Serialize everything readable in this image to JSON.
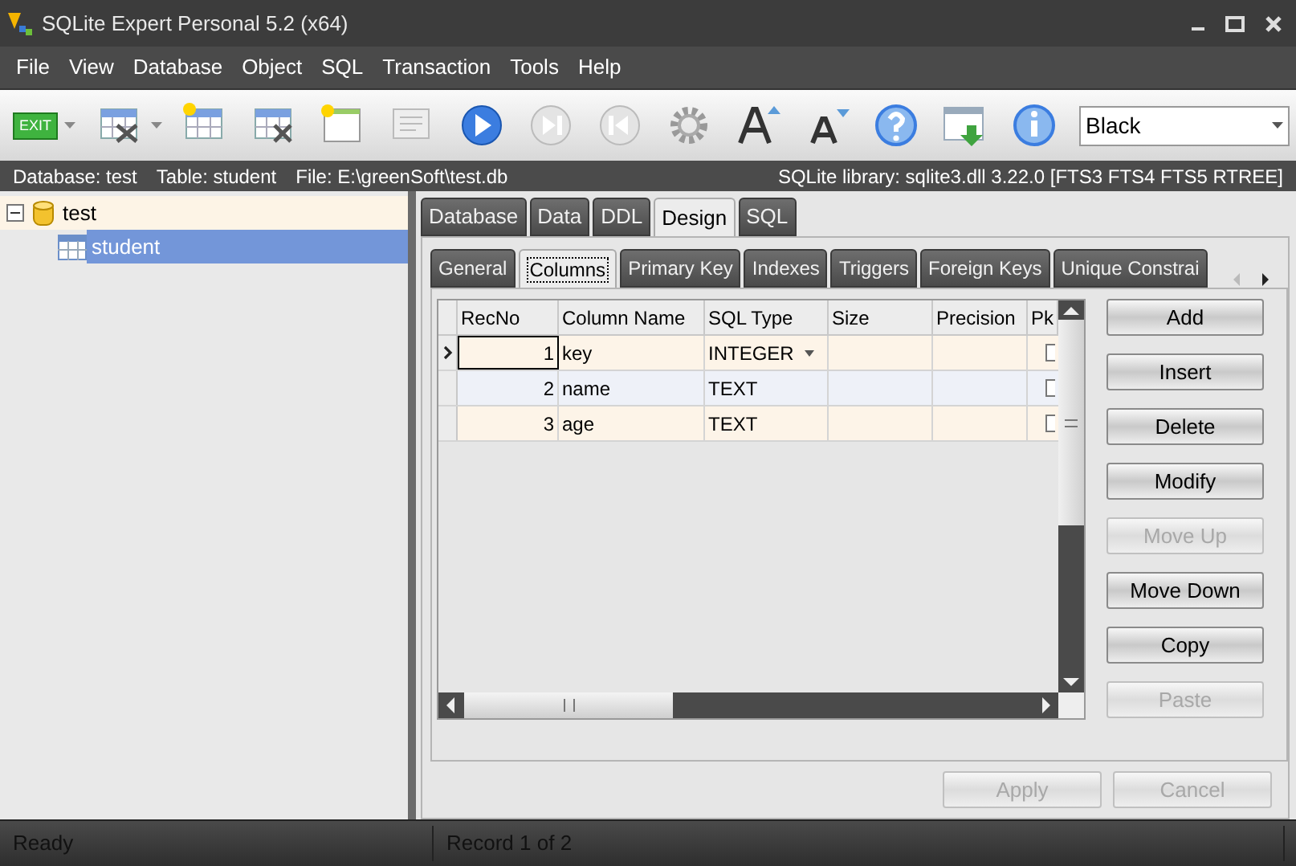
{
  "window": {
    "title": "SQLite Expert Personal 5.2 (x64)"
  },
  "menu": [
    "File",
    "View",
    "Database",
    "Object",
    "SQL",
    "Transaction",
    "Tools",
    "Help"
  ],
  "toolbar": {
    "exit_label": "EXIT",
    "theme": "Black"
  },
  "info_bar": {
    "left": [
      "Database: test",
      "Table: student",
      "File: E:\\greenSoft\\test.db"
    ],
    "right": "SQLite library: sqlite3.dll 3.22.0 [FTS3 FTS4 FTS5 RTREE]"
  },
  "tree": [
    {
      "label": "test",
      "expanded": true,
      "selected": false,
      "children": [
        {
          "label": "student",
          "selected": true
        }
      ]
    }
  ],
  "main_tabs": [
    {
      "label": "Database",
      "selected": false
    },
    {
      "label": "Data",
      "selected": false
    },
    {
      "label": "DDL",
      "selected": false
    },
    {
      "label": "Design",
      "selected": true
    },
    {
      "label": "SQL",
      "selected": false
    }
  ],
  "sub_tabs": [
    {
      "label": "General",
      "selected": false
    },
    {
      "label": "Columns",
      "selected": true
    },
    {
      "label": "Primary Key",
      "selected": false
    },
    {
      "label": "Indexes",
      "selected": false
    },
    {
      "label": "Triggers",
      "selected": false
    },
    {
      "label": "Foreign Keys",
      "selected": false
    },
    {
      "label": "Unique Constrai",
      "selected": false
    }
  ],
  "grid": {
    "columns": [
      "RecNo",
      "Column Name",
      "SQL Type",
      "Size",
      "Precision",
      "Pk"
    ],
    "rows": [
      {
        "cells": [
          "1",
          "key",
          "INTEGER",
          "",
          ""
        ],
        "current": true
      },
      {
        "cells": [
          "2",
          "name",
          "TEXT",
          "",
          ""
        ],
        "current": false
      },
      {
        "cells": [
          "3",
          "age",
          "TEXT",
          "",
          ""
        ],
        "current": false
      }
    ]
  },
  "buttons": [
    {
      "label": "Add",
      "disabled": false
    },
    {
      "label": "Insert",
      "disabled": false
    },
    {
      "label": "Delete",
      "disabled": false
    },
    {
      "label": "Modify",
      "disabled": false
    },
    {
      "label": "Move Up",
      "disabled": true
    },
    {
      "label": "Move Down",
      "disabled": false
    },
    {
      "label": "Copy",
      "disabled": false
    },
    {
      "label": "Paste",
      "disabled": true
    }
  ],
  "footer_buttons": [
    {
      "label": "Apply",
      "disabled": true
    },
    {
      "label": "Cancel",
      "disabled": true
    }
  ],
  "status_bar": [
    "Ready",
    "Record 1 of 2"
  ]
}
